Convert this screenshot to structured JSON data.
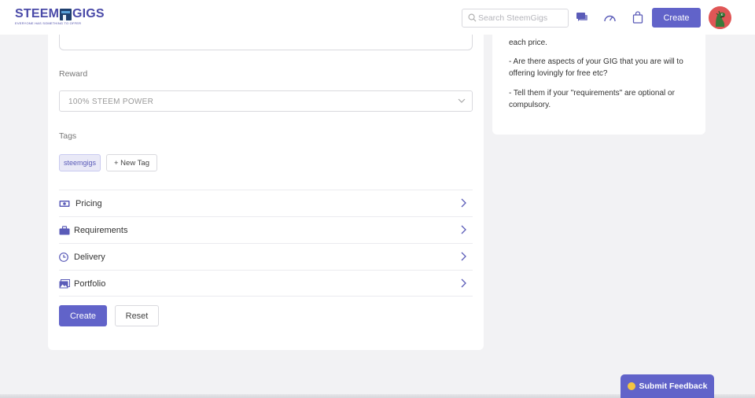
{
  "header": {
    "logo_left": "STEEM",
    "logo_right": "GIGS",
    "logo_tagline": "EVERYONE HAS SOMETHING TO OFFER",
    "search_placeholder": "Search SteemGigs",
    "create_label": "Create"
  },
  "form": {
    "reward_label": "Reward",
    "reward_value": "100% STEEM POWER",
    "tags_label": "Tags",
    "tag_chip": "steemgigs",
    "new_tag_label": "+ New Tag",
    "sections": [
      {
        "label": "Pricing",
        "icon": "money-icon"
      },
      {
        "label": "Requirements",
        "icon": "briefcase-icon"
      },
      {
        "label": "Delivery",
        "icon": "clock-icon"
      },
      {
        "label": "Portfolio",
        "icon": "images-icon"
      }
    ],
    "create_label": "Create",
    "reset_label": "Reset"
  },
  "tips": {
    "line1": "each price.",
    "line2": "- Are there aspects of your GIG that you are will to offering lovingly for free etc?",
    "line3": "- Tell them if your \"requirements\" are optional or compulsory."
  },
  "feedback": {
    "label": "Submit Feedback"
  },
  "colors": {
    "accent": "#6163c9",
    "brand": "#4a4aa8",
    "page_bg": "#f2f2f4"
  }
}
